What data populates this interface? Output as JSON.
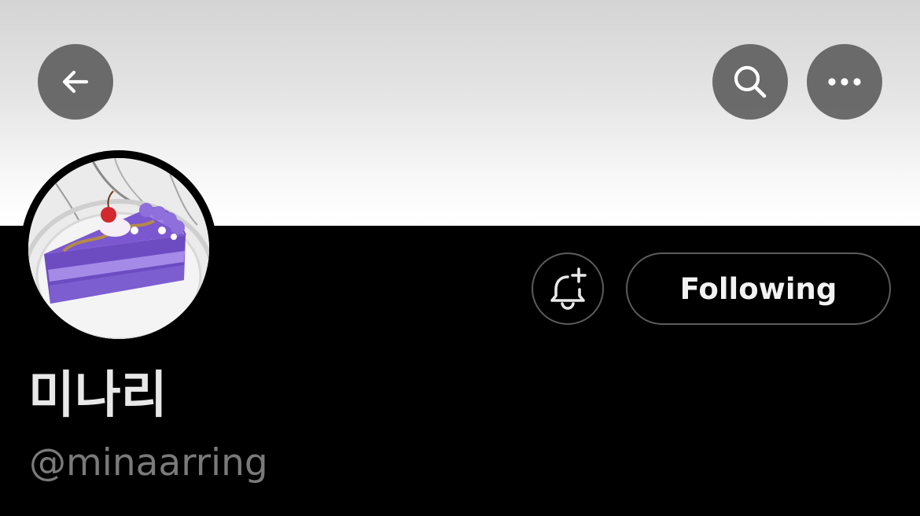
{
  "header": {
    "back_icon": "arrow-left-icon",
    "search_icon": "search-icon",
    "more_icon": "more-horizontal-icon"
  },
  "profile": {
    "avatar_description_icon": "avatar",
    "display_name": "미나리",
    "handle": "@minaarring"
  },
  "actions": {
    "notification_icon": "bell-plus-icon",
    "following_label": "Following"
  },
  "colors": {
    "background": "#000000",
    "banner_top": "#d4d4d4",
    "banner_bottom": "#ffffff",
    "overlay_button": "#5f5f5f",
    "text_primary": "#e8e8e8",
    "text_secondary": "#7a7a7a",
    "outline": "#5c5c5c"
  }
}
